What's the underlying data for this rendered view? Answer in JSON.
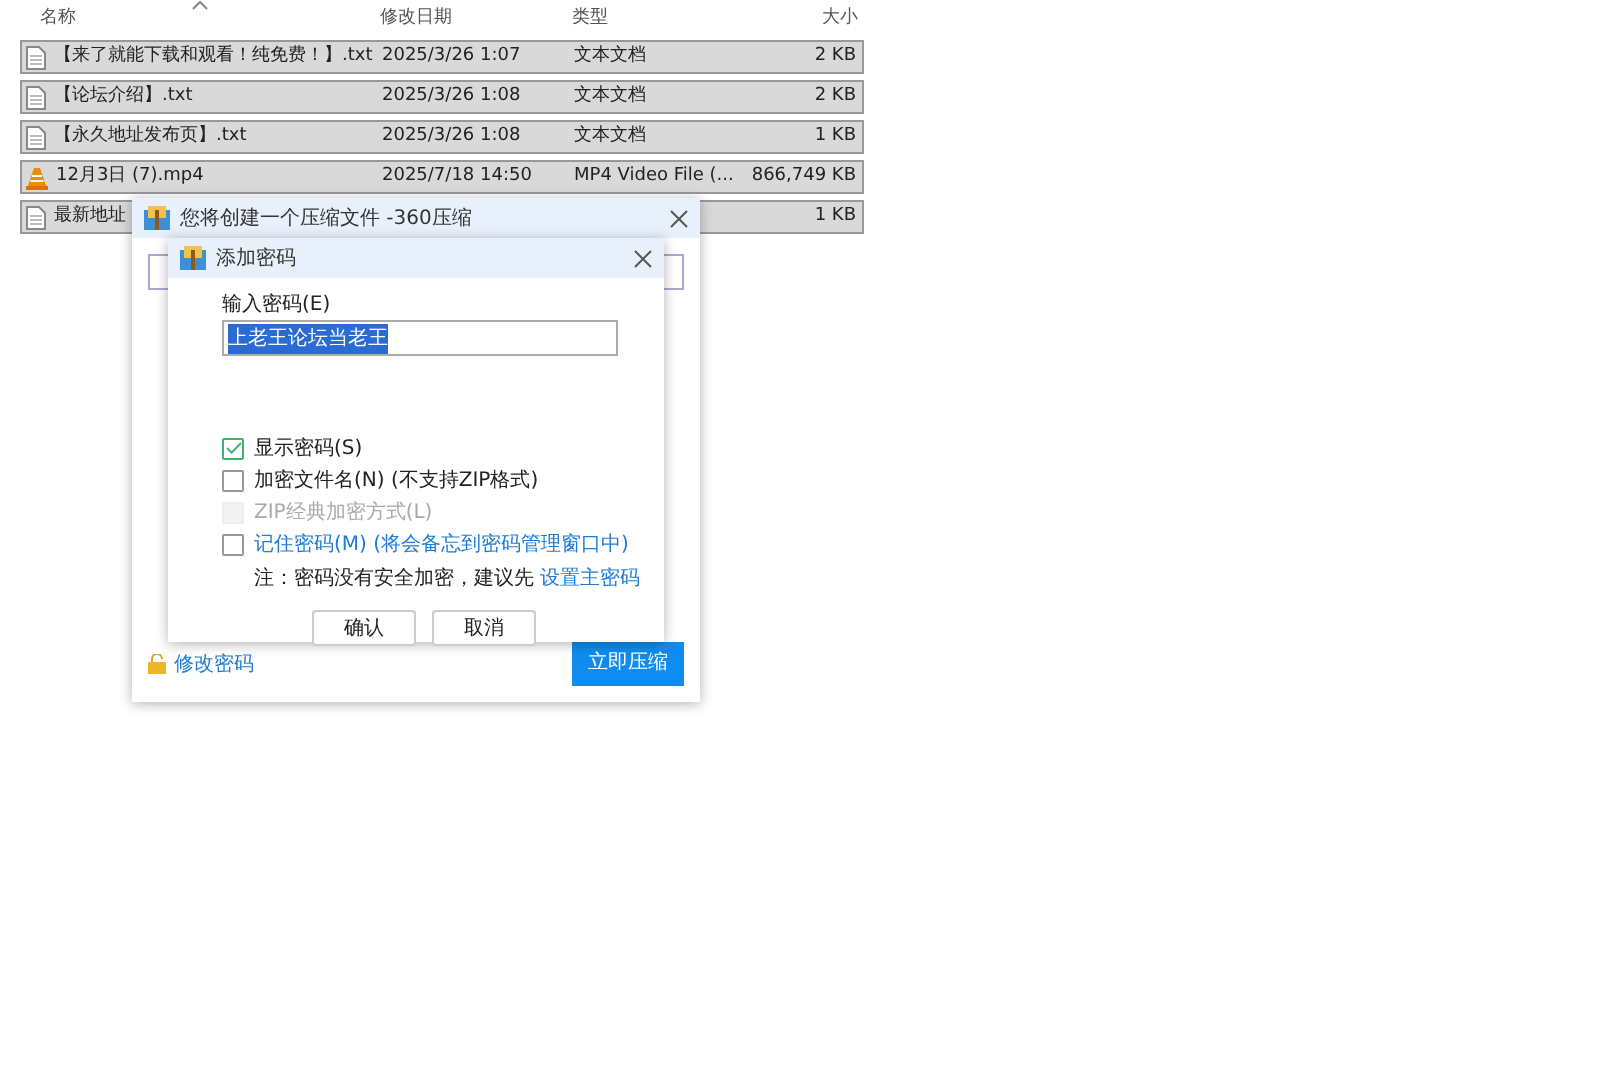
{
  "file_list": {
    "columns": [
      {
        "label": "名称",
        "sorted": true
      },
      {
        "label": "修改日期",
        "sorted": false
      },
      {
        "label": "类型",
        "sorted": false
      },
      {
        "label": "大小",
        "sorted": false
      }
    ],
    "rows": [
      {
        "kind": "text",
        "name": "【来了就能下载和观看！纯免费！】.txt",
        "modified": "2025/3/26 1:07",
        "type": "文本文档",
        "size": "2 KB",
        "selected": true
      },
      {
        "kind": "text",
        "name": "【论坛介绍】.txt",
        "modified": "2025/3/26 1:08",
        "type": "文本文档",
        "size": "2 KB",
        "selected": true
      },
      {
        "kind": "text",
        "name": "【永久地址发布页】.txt",
        "modified": "2025/3/26 1:08",
        "type": "文本文档",
        "size": "1 KB",
        "selected": true
      },
      {
        "kind": "video",
        "name": "12月3日 (7).mp4",
        "modified": "2025/7/18 14:50",
        "type": "MP4 Video File (...",
        "size": "866,749 KB",
        "selected": true
      },
      {
        "kind": "text",
        "name": "最新地址",
        "size": "1 KB",
        "selected": true
      }
    ]
  },
  "compress_dialog": {
    "title": "您将创建一个压缩文件 -360压缩",
    "change_password_link": "修改密码",
    "compress_button": "立即压缩"
  },
  "password_dialog": {
    "title": "添加密码",
    "field_label": "输入密码(E)",
    "password": "上老王论坛当老王",
    "password_selected": true,
    "options": [
      {
        "kind": "option",
        "label": "显示密码(S)",
        "checked": true,
        "disabled": false
      },
      {
        "kind": "option",
        "label": "加密文件名(N) (不支持ZIP格式)",
        "checked": false,
        "disabled": false
      },
      {
        "kind": "option",
        "label": "ZIP经典加密方式(L)",
        "checked": false,
        "disabled": true
      },
      {
        "kind": "link",
        "label": "记住密码(M) (将会备忘到密码管理窗口中)",
        "checked": false,
        "disabled": false
      }
    ],
    "note": "注：密码没有安全加密，建议先",
    "note_link": "设置主密码",
    "buttons": [
      "确认",
      "取消"
    ]
  }
}
